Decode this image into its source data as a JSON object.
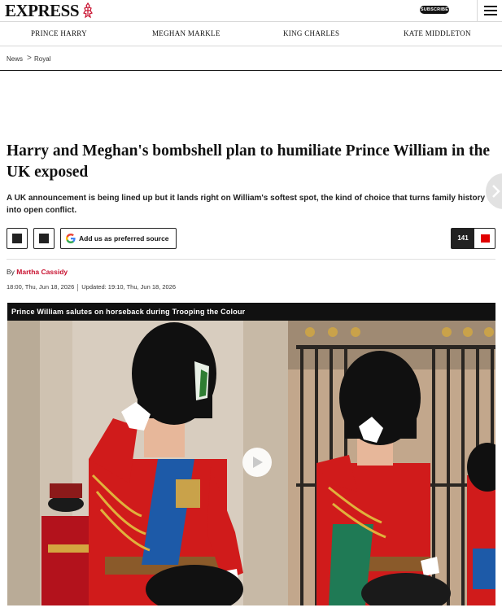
{
  "header": {
    "logo_text": "EXPRESS",
    "subscribe_label": "SUBSCRIBE",
    "menu_icon": "hamburger-icon"
  },
  "nav": {
    "items": [
      "PRINCE HARRY",
      "MEGHAN MARKLE",
      "KING CHARLES",
      "KATE MIDDLETON"
    ]
  },
  "breadcrumb": {
    "items": [
      "News",
      "Royal"
    ],
    "separator": ">"
  },
  "article": {
    "headline": "Harry and Meghan's bombshell plan to humiliate Prince William in the UK exposed",
    "standfirst": "A UK announcement is being lined up but it lands right on William's softest spot, the kind of choice that turns family history into open conflict.",
    "google_button_label": "Add us as preferred source",
    "comment_count": "141",
    "byline_prefix": "By",
    "author": "Martha Cassidy",
    "published": "18:00, Thu, Jun 18, 2026",
    "updated": "Updated: 19:10, Thu, Jun 18, 2026"
  },
  "media": {
    "caption": "Prince William salutes on horseback during Trooping the Colour"
  },
  "colors": {
    "accent_red": "#c8102e",
    "comment_red": "#e10000",
    "dark": "#222222"
  }
}
